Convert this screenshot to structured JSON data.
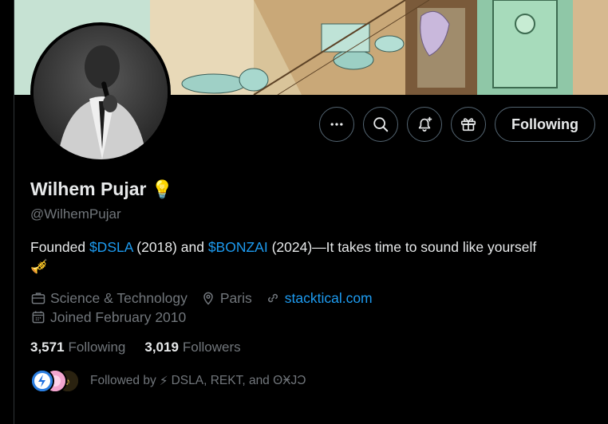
{
  "profile": {
    "name": "Wilhem Pujar",
    "name_emoji": "💡",
    "handle": "@WilhemPujar",
    "bio": {
      "t1": "Founded ",
      "link1": "$DSLA",
      "t2": " (2018) and ",
      "link2": "$BONZAI",
      "t3": " (2024)—It takes time to sound like yourself",
      "emoji": "🎺"
    },
    "category": "Science & Technology",
    "location": "Paris",
    "website": "stacktical.com",
    "joined": "Joined February 2010"
  },
  "actions": {
    "more_icon": "more-icon",
    "search_icon": "search-icon",
    "notify_icon": "bell-plus-icon",
    "subscribe_icon": "gift-icon",
    "follow_label": "Following"
  },
  "stats": {
    "following_count": "3,571",
    "following_label": "Following",
    "followers_count": "3,019",
    "followers_label": "Followers"
  },
  "followed_by": {
    "prefix": "Followed by",
    "emoji": "⚡",
    "names": "DSLA, REKT, and ʘӾJƆ"
  },
  "colors": {
    "link": "#1d9bf0",
    "secondary_text": "#71767b",
    "primary_text": "#e7e9ea",
    "border": "#536471"
  }
}
